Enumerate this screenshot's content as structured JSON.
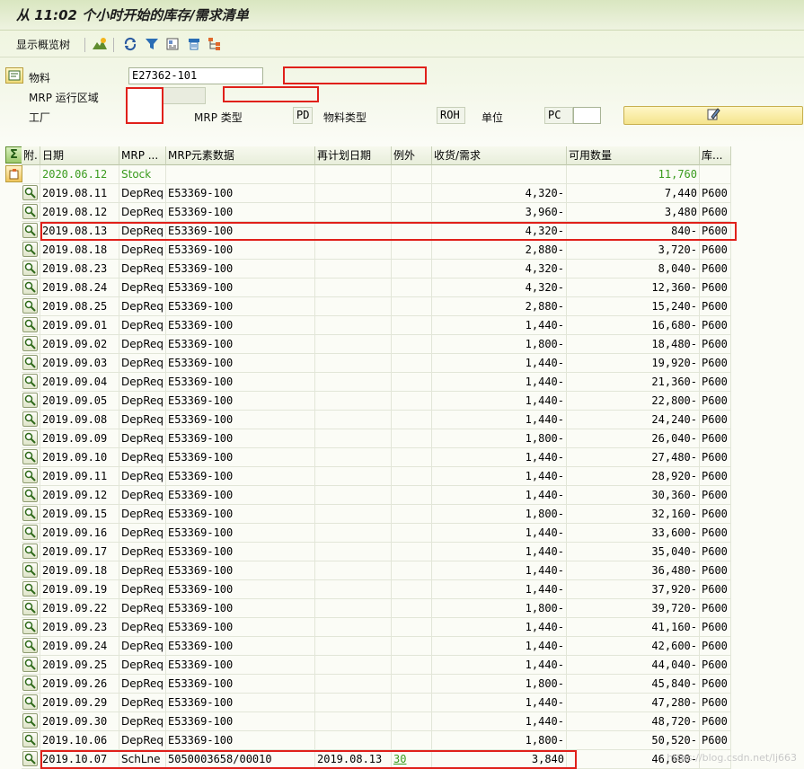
{
  "window": {
    "title": "从 11:02 个小时开始的库存/需求清单"
  },
  "toolbar": {
    "overview_tree_label": "显示概览树"
  },
  "header": {
    "material_label": "物料",
    "material_value": "E27362-101",
    "mrp_area_label": "MRP 运行区域",
    "plant_label": "工厂",
    "mrp_type_label": "MRP 类型",
    "mrp_type_value": "PD",
    "material_type_label": "物料类型",
    "material_type_value": "ROH",
    "unit_label": "单位",
    "unit_value": "PC"
  },
  "table": {
    "columns": [
      "附.",
      "日期",
      "MRP ...",
      "MRP元素数据",
      "再计划日期",
      "例外",
      "收货/需求",
      "可用数量",
      "库..."
    ],
    "first_row": {
      "date": "2020.06.12",
      "mrp_element": "Stock",
      "available": "11,760"
    },
    "rows": [
      {
        "date": "2019.08.11",
        "mrp": "DepReq",
        "data": "E53369-100",
        "reschedule": "",
        "exception": "",
        "qty": "4,320-",
        "avail": "7,440",
        "stor": "P600"
      },
      {
        "date": "2019.08.12",
        "mrp": "DepReq",
        "data": "E53369-100",
        "reschedule": "",
        "exception": "",
        "qty": "3,960-",
        "avail": "3,480",
        "stor": "P600"
      },
      {
        "date": "2019.08.13",
        "mrp": "DepReq",
        "data": "E53369-100",
        "reschedule": "",
        "exception": "",
        "qty": "4,320-",
        "avail": "840-",
        "stor": "P600"
      },
      {
        "date": "2019.08.18",
        "mrp": "DepReq",
        "data": "E53369-100",
        "reschedule": "",
        "exception": "",
        "qty": "2,880-",
        "avail": "3,720-",
        "stor": "P600"
      },
      {
        "date": "2019.08.23",
        "mrp": "DepReq",
        "data": "E53369-100",
        "reschedule": "",
        "exception": "",
        "qty": "4,320-",
        "avail": "8,040-",
        "stor": "P600"
      },
      {
        "date": "2019.08.24",
        "mrp": "DepReq",
        "data": "E53369-100",
        "reschedule": "",
        "exception": "",
        "qty": "4,320-",
        "avail": "12,360-",
        "stor": "P600"
      },
      {
        "date": "2019.08.25",
        "mrp": "DepReq",
        "data": "E53369-100",
        "reschedule": "",
        "exception": "",
        "qty": "2,880-",
        "avail": "15,240-",
        "stor": "P600"
      },
      {
        "date": "2019.09.01",
        "mrp": "DepReq",
        "data": "E53369-100",
        "reschedule": "",
        "exception": "",
        "qty": "1,440-",
        "avail": "16,680-",
        "stor": "P600"
      },
      {
        "date": "2019.09.02",
        "mrp": "DepReq",
        "data": "E53369-100",
        "reschedule": "",
        "exception": "",
        "qty": "1,800-",
        "avail": "18,480-",
        "stor": "P600"
      },
      {
        "date": "2019.09.03",
        "mrp": "DepReq",
        "data": "E53369-100",
        "reschedule": "",
        "exception": "",
        "qty": "1,440-",
        "avail": "19,920-",
        "stor": "P600"
      },
      {
        "date": "2019.09.04",
        "mrp": "DepReq",
        "data": "E53369-100",
        "reschedule": "",
        "exception": "",
        "qty": "1,440-",
        "avail": "21,360-",
        "stor": "P600"
      },
      {
        "date": "2019.09.05",
        "mrp": "DepReq",
        "data": "E53369-100",
        "reschedule": "",
        "exception": "",
        "qty": "1,440-",
        "avail": "22,800-",
        "stor": "P600"
      },
      {
        "date": "2019.09.08",
        "mrp": "DepReq",
        "data": "E53369-100",
        "reschedule": "",
        "exception": "",
        "qty": "1,440-",
        "avail": "24,240-",
        "stor": "P600"
      },
      {
        "date": "2019.09.09",
        "mrp": "DepReq",
        "data": "E53369-100",
        "reschedule": "",
        "exception": "",
        "qty": "1,800-",
        "avail": "26,040-",
        "stor": "P600"
      },
      {
        "date": "2019.09.10",
        "mrp": "DepReq",
        "data": "E53369-100",
        "reschedule": "",
        "exception": "",
        "qty": "1,440-",
        "avail": "27,480-",
        "stor": "P600"
      },
      {
        "date": "2019.09.11",
        "mrp": "DepReq",
        "data": "E53369-100",
        "reschedule": "",
        "exception": "",
        "qty": "1,440-",
        "avail": "28,920-",
        "stor": "P600"
      },
      {
        "date": "2019.09.12",
        "mrp": "DepReq",
        "data": "E53369-100",
        "reschedule": "",
        "exception": "",
        "qty": "1,440-",
        "avail": "30,360-",
        "stor": "P600"
      },
      {
        "date": "2019.09.15",
        "mrp": "DepReq",
        "data": "E53369-100",
        "reschedule": "",
        "exception": "",
        "qty": "1,800-",
        "avail": "32,160-",
        "stor": "P600"
      },
      {
        "date": "2019.09.16",
        "mrp": "DepReq",
        "data": "E53369-100",
        "reschedule": "",
        "exception": "",
        "qty": "1,440-",
        "avail": "33,600-",
        "stor": "P600"
      },
      {
        "date": "2019.09.17",
        "mrp": "DepReq",
        "data": "E53369-100",
        "reschedule": "",
        "exception": "",
        "qty": "1,440-",
        "avail": "35,040-",
        "stor": "P600"
      },
      {
        "date": "2019.09.18",
        "mrp": "DepReq",
        "data": "E53369-100",
        "reschedule": "",
        "exception": "",
        "qty": "1,440-",
        "avail": "36,480-",
        "stor": "P600"
      },
      {
        "date": "2019.09.19",
        "mrp": "DepReq",
        "data": "E53369-100",
        "reschedule": "",
        "exception": "",
        "qty": "1,440-",
        "avail": "37,920-",
        "stor": "P600"
      },
      {
        "date": "2019.09.22",
        "mrp": "DepReq",
        "data": "E53369-100",
        "reschedule": "",
        "exception": "",
        "qty": "1,800-",
        "avail": "39,720-",
        "stor": "P600"
      },
      {
        "date": "2019.09.23",
        "mrp": "DepReq",
        "data": "E53369-100",
        "reschedule": "",
        "exception": "",
        "qty": "1,440-",
        "avail": "41,160-",
        "stor": "P600"
      },
      {
        "date": "2019.09.24",
        "mrp": "DepReq",
        "data": "E53369-100",
        "reschedule": "",
        "exception": "",
        "qty": "1,440-",
        "avail": "42,600-",
        "stor": "P600"
      },
      {
        "date": "2019.09.25",
        "mrp": "DepReq",
        "data": "E53369-100",
        "reschedule": "",
        "exception": "",
        "qty": "1,440-",
        "avail": "44,040-",
        "stor": "P600"
      },
      {
        "date": "2019.09.26",
        "mrp": "DepReq",
        "data": "E53369-100",
        "reschedule": "",
        "exception": "",
        "qty": "1,800-",
        "avail": "45,840-",
        "stor": "P600"
      },
      {
        "date": "2019.09.29",
        "mrp": "DepReq",
        "data": "E53369-100",
        "reschedule": "",
        "exception": "",
        "qty": "1,440-",
        "avail": "47,280-",
        "stor": "P600"
      },
      {
        "date": "2019.09.30",
        "mrp": "DepReq",
        "data": "E53369-100",
        "reschedule": "",
        "exception": "",
        "qty": "1,440-",
        "avail": "48,720-",
        "stor": "P600"
      },
      {
        "date": "2019.10.06",
        "mrp": "DepReq",
        "data": "E53369-100",
        "reschedule": "",
        "exception": "",
        "qty": "1,800-",
        "avail": "50,520-",
        "stor": "P600"
      },
      {
        "date": "2019.10.07",
        "mrp": "SchLne",
        "data": "5050003658/00010",
        "reschedule": "2019.08.13",
        "exception": "30",
        "qty": "3,840",
        "avail": "46,680-",
        "stor": ""
      }
    ]
  },
  "watermark": "https://blog.csdn.net/lj663",
  "colors": {
    "highlight_box": "#e0201a",
    "stock_green": "#3a9b1e",
    "title_bg": "#d9e6c0"
  },
  "icons": [
    "expand-icon",
    "refresh-icon",
    "filter-icon",
    "save-layout-icon",
    "print-icon",
    "hierarchy-icon",
    "edit-icon",
    "sum-icon",
    "detail-icon"
  ]
}
